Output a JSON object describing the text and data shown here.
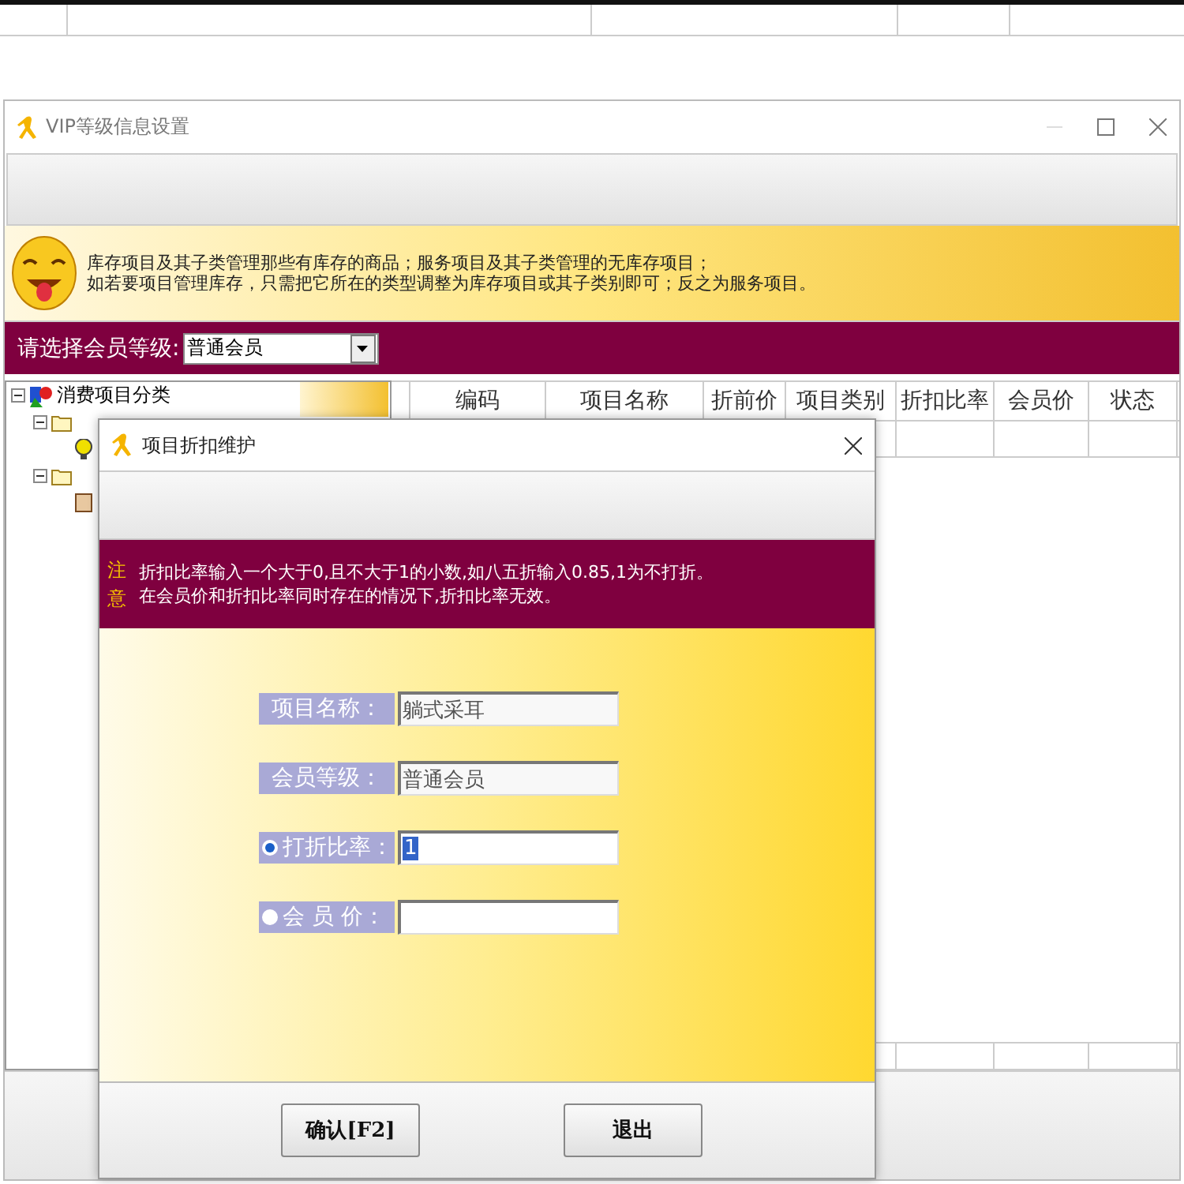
{
  "main_window": {
    "title": "VIP等级信息设置",
    "notice_lines": [
      "库存项目及其子类管理那些有库存的商品；服务项目及其子类管理的无库存项目；",
      "如若要项目管理库存，只需把它所在的类型调整为库存项目或其子类别即可；反之为服务项目。"
    ],
    "level_label": "请选择会员等级:",
    "level_select": {
      "value": "普通会员"
    },
    "tree": {
      "label": "消费项目分类",
      "expanded": true,
      "children": [
        {
          "kind": "folder",
          "expanded": true,
          "children": [
            {
              "kind": "bulb"
            }
          ]
        },
        {
          "kind": "folder",
          "expanded": true,
          "children": [
            {
              "kind": "box"
            }
          ]
        }
      ]
    },
    "grid": {
      "columns": [
        "编码",
        "项目名称",
        "折前价",
        "项目类别",
        "折扣比率",
        "会员价",
        "状态"
      ]
    }
  },
  "dialog": {
    "title": "项目折扣维护",
    "notice_marks": [
      "注",
      "意"
    ],
    "notice_lines": [
      "折扣比率输入一个大于0,且不大于1的小数,如八五折输入0.85,1为不打折。",
      "在会员价和折扣比率同时存在的情况下,折扣比率无效。"
    ],
    "fields": [
      {
        "kind": "text",
        "label": "项目名称：",
        "value": "躺式采耳"
      },
      {
        "kind": "text",
        "label": "会员等级：",
        "value": "普通会员"
      },
      {
        "kind": "radio",
        "label": "打折比率：",
        "value": "1",
        "selected": true
      },
      {
        "kind": "radio",
        "label": "会 员 价：",
        "selected": false
      }
    ],
    "buttons": [
      "确认[F2]",
      "退出"
    ]
  }
}
